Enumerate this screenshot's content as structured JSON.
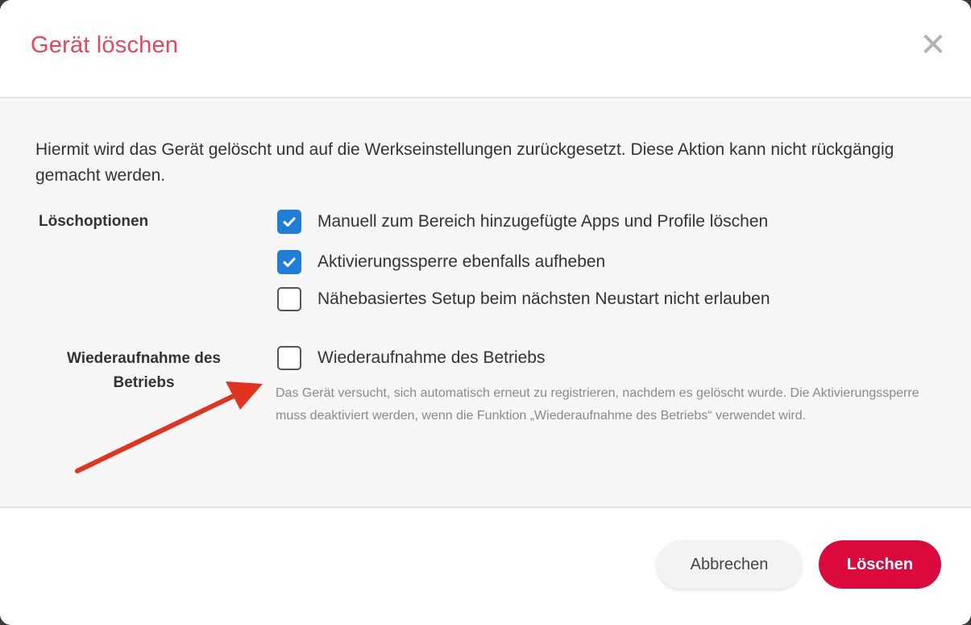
{
  "dialog": {
    "title": "Gerät löschen",
    "close_glyph": "✕",
    "description": "Hiermit wird das Gerät gelöscht und auf die Werkseinstellungen zurückgesetzt. Diese Aktion kann nicht rückgängig gemacht werden."
  },
  "options": {
    "label": "Löschoptionen",
    "items": [
      {
        "label": "Manuell zum Bereich hinzugefügte Apps und Profile löschen",
        "checked": true
      },
      {
        "label": "Aktivierungssperre ebenfalls aufheben",
        "checked": true
      },
      {
        "label": "Nähebasiertes Setup beim nächsten Neustart nicht erlauben",
        "checked": false
      }
    ]
  },
  "resume": {
    "label": "Wiederaufnahme des Betriebs",
    "option_label": "Wiederaufnahme des Betriebs",
    "checked": false,
    "help": "Das Gerät versucht, sich automatisch erneut zu registrieren, nachdem es gelöscht wurde. Die Aktivierungssperre muss deaktiviert werden, wenn die Funktion „Wiederaufnahme des Betriebs“ verwendet wird."
  },
  "footer": {
    "cancel_label": "Abbrechen",
    "delete_label": "Löschen"
  },
  "colors": {
    "title": "#e8465a",
    "checkbox_checked": "#1f7fd8",
    "delete_button": "#dc0a3c",
    "annotation_arrow": "#e0341f"
  },
  "icons": {
    "close": "close-icon",
    "check": "checkmark-icon",
    "annotation": "arrow-annotation"
  }
}
